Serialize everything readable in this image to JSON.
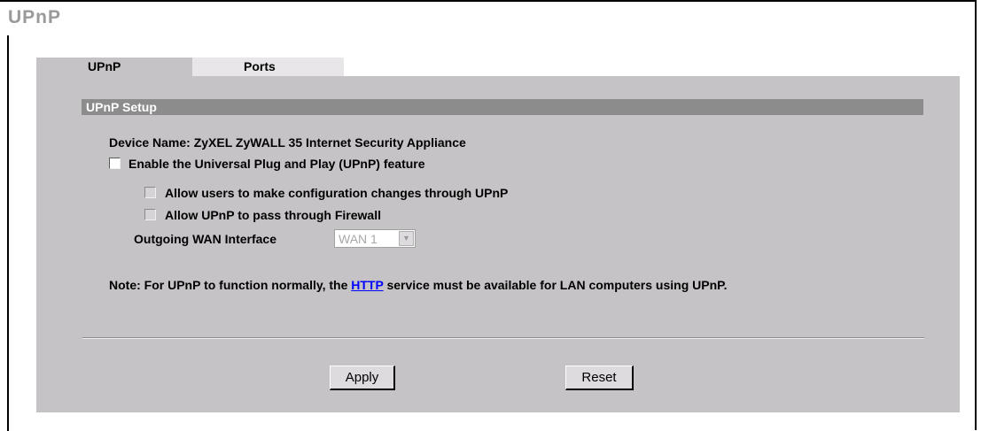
{
  "page": {
    "title": "UPnP"
  },
  "tabs": [
    {
      "label": "UPnP",
      "active": true
    },
    {
      "label": "Ports",
      "active": false
    }
  ],
  "section": {
    "title": "UPnP Setup"
  },
  "device": {
    "label": "Device Name: ZyXEL ZyWALL 35 Internet Security Appliance"
  },
  "options": {
    "enable_upnp": {
      "label": "Enable the Universal Plug and Play (UPnP) feature",
      "checked": false
    },
    "allow_config": {
      "label": "Allow users to make configuration changes through UPnP",
      "checked": false,
      "disabled": true
    },
    "allow_firewall": {
      "label": "Allow UPnP to pass through Firewall",
      "checked": false,
      "disabled": true
    }
  },
  "wan": {
    "label": "Outgoing WAN Interface",
    "selected": "WAN 1"
  },
  "note": {
    "prefix": "Note: For UPnP to function normally, the ",
    "link": "HTTP",
    "suffix": " service must be available for LAN computers using UPnP."
  },
  "buttons": {
    "apply": "Apply",
    "reset": "Reset"
  },
  "colors": {
    "panel": "#c6c3c6",
    "section_bar": "#8c8c8c",
    "link": "#0000ff",
    "title": "#9a9a9a"
  }
}
